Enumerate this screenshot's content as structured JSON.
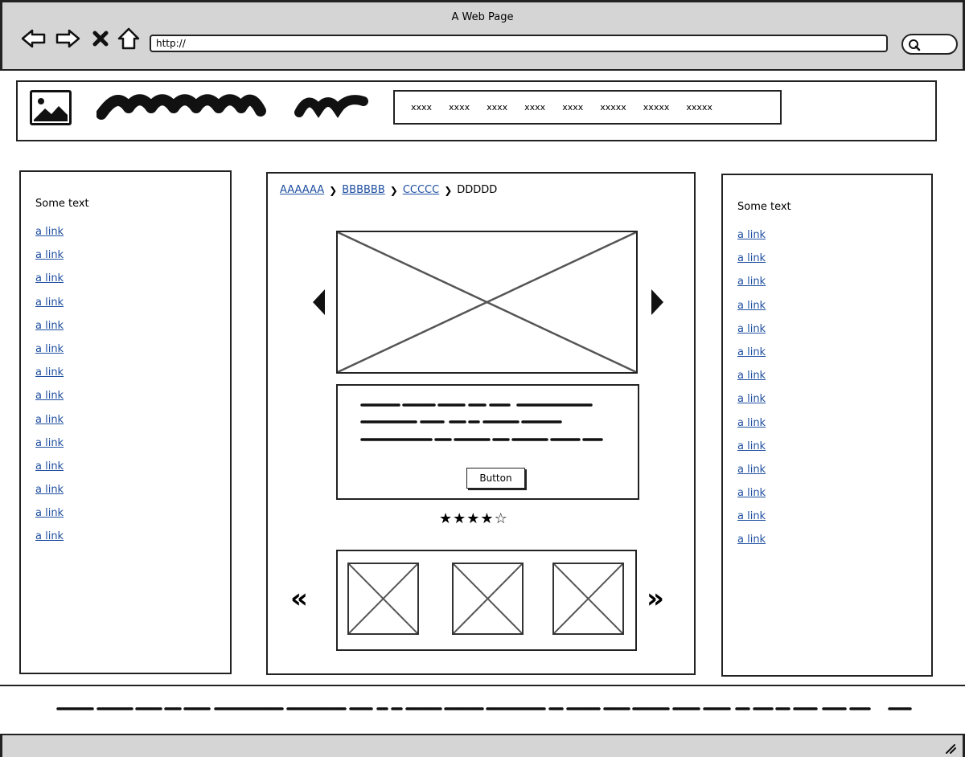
{
  "window": {
    "title": "A Web Page",
    "url": "http://"
  },
  "toolbar": {
    "icons": [
      "back-arrow-icon",
      "forward-arrow-icon",
      "close-icon",
      "home-icon",
      "search-icon"
    ]
  },
  "header": {
    "menu_items": [
      "xxxx",
      "xxxx",
      "xxxx",
      "xxxx",
      "xxxx",
      "xxxxx",
      "xxxxx",
      "xxxxx"
    ]
  },
  "left_sidebar": {
    "title": "Some text",
    "links": [
      "a link",
      "a link",
      "a link",
      "a link",
      "a link",
      "a link",
      "a link",
      "a link",
      "a link",
      "a link",
      "a link",
      "a link",
      "a link",
      "a link"
    ]
  },
  "right_sidebar": {
    "title": "Some text",
    "links": [
      "a link",
      "a link",
      "a link",
      "a link",
      "a link",
      "a link",
      "a link",
      "a link",
      "a link",
      "a link",
      "a link",
      "a link",
      "a link",
      "a link"
    ]
  },
  "main": {
    "breadcrumb": [
      "AAAAAA",
      "BBBBBB",
      "CCCCC",
      "DDDDD"
    ],
    "button_label": "Button",
    "rating": {
      "value": 4,
      "max": 5
    }
  },
  "colors": {
    "link": "#1f4fa0",
    "chrome": "#d5d5d5",
    "border": "#222222"
  }
}
